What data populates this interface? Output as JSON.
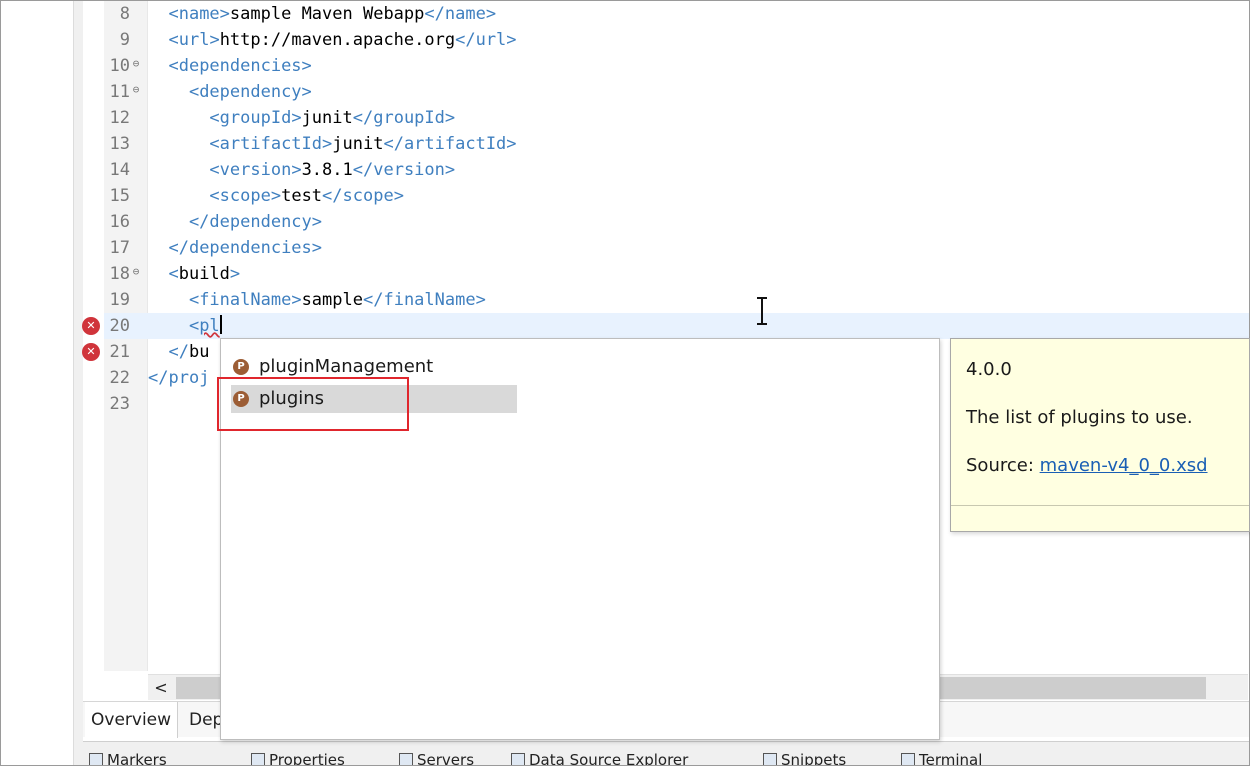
{
  "editor": {
    "lines": [
      {
        "num": "8",
        "fold": false,
        "error": false,
        "current": false,
        "parts": [
          [
            "tg",
            "  <"
          ],
          [
            "tg",
            "name"
          ],
          [
            "tg",
            ">"
          ],
          [
            "bk",
            "sample Maven Webapp"
          ],
          [
            "tg",
            "</"
          ],
          [
            "tg",
            "name"
          ],
          [
            "tg",
            ">"
          ]
        ]
      },
      {
        "num": "9",
        "fold": false,
        "error": false,
        "current": false,
        "parts": [
          [
            "tg",
            "  <"
          ],
          [
            "tg",
            "url"
          ],
          [
            "tg",
            ">"
          ],
          [
            "bk",
            "http://maven.apache.org"
          ],
          [
            "tg",
            "</"
          ],
          [
            "tg",
            "url"
          ],
          [
            "tg",
            ">"
          ]
        ]
      },
      {
        "num": "10",
        "fold": true,
        "error": false,
        "current": false,
        "parts": [
          [
            "tg",
            "  <"
          ],
          [
            "tg",
            "dependencies"
          ],
          [
            "tg",
            ">"
          ]
        ]
      },
      {
        "num": "11",
        "fold": true,
        "error": false,
        "current": false,
        "parts": [
          [
            "tg",
            "    <"
          ],
          [
            "tg",
            "dependency"
          ],
          [
            "tg",
            ">"
          ]
        ]
      },
      {
        "num": "12",
        "fold": false,
        "error": false,
        "current": false,
        "parts": [
          [
            "tg",
            "      <"
          ],
          [
            "tg",
            "groupId"
          ],
          [
            "tg",
            ">"
          ],
          [
            "bk",
            "junit"
          ],
          [
            "tg",
            "</"
          ],
          [
            "tg",
            "groupId"
          ],
          [
            "tg",
            ">"
          ]
        ]
      },
      {
        "num": "13",
        "fold": false,
        "error": false,
        "current": false,
        "parts": [
          [
            "tg",
            "      <"
          ],
          [
            "tg",
            "artifactId"
          ],
          [
            "tg",
            ">"
          ],
          [
            "bk",
            "junit"
          ],
          [
            "tg",
            "</"
          ],
          [
            "tg",
            "artifactId"
          ],
          [
            "tg",
            ">"
          ]
        ]
      },
      {
        "num": "14",
        "fold": false,
        "error": false,
        "current": false,
        "parts": [
          [
            "tg",
            "      <"
          ],
          [
            "tg",
            "version"
          ],
          [
            "tg",
            ">"
          ],
          [
            "bk",
            "3.8.1"
          ],
          [
            "tg",
            "</"
          ],
          [
            "tg",
            "version"
          ],
          [
            "tg",
            ">"
          ]
        ]
      },
      {
        "num": "15",
        "fold": false,
        "error": false,
        "current": false,
        "parts": [
          [
            "tg",
            "      <"
          ],
          [
            "tg",
            "scope"
          ],
          [
            "tg",
            ">"
          ],
          [
            "bk",
            "test"
          ],
          [
            "tg",
            "</"
          ],
          [
            "tg",
            "scope"
          ],
          [
            "tg",
            ">"
          ]
        ]
      },
      {
        "num": "16",
        "fold": false,
        "error": false,
        "current": false,
        "parts": [
          [
            "tg",
            "    </"
          ],
          [
            "tg",
            "dependency"
          ],
          [
            "tg",
            ">"
          ]
        ]
      },
      {
        "num": "17",
        "fold": false,
        "error": false,
        "current": false,
        "parts": [
          [
            "tg",
            "  </"
          ],
          [
            "tg",
            "dependencies"
          ],
          [
            "tg",
            ">"
          ]
        ]
      },
      {
        "num": "18",
        "fold": true,
        "error": false,
        "current": false,
        "parts": [
          [
            "tg",
            "  <"
          ],
          [
            "bk",
            "build"
          ],
          [
            "tg",
            ">"
          ]
        ]
      },
      {
        "num": "19",
        "fold": false,
        "error": false,
        "current": false,
        "parts": [
          [
            "tg",
            "    <"
          ],
          [
            "tg",
            "finalName"
          ],
          [
            "tg",
            ">"
          ],
          [
            "bk",
            "sample"
          ],
          [
            "tg",
            "</"
          ],
          [
            "tg",
            "finalName"
          ],
          [
            "tg",
            ">"
          ]
        ]
      },
      {
        "num": "20",
        "fold": false,
        "error": true,
        "current": true,
        "parts": [
          [
            "tg",
            "    <"
          ],
          [
            "squig",
            "pl"
          ]
        ]
      },
      {
        "num": "21",
        "fold": false,
        "error": true,
        "current": false,
        "parts": [
          [
            "tg",
            "  </"
          ],
          [
            "bk",
            "bu"
          ]
        ]
      },
      {
        "num": "22",
        "fold": false,
        "error": false,
        "current": false,
        "parts": [
          [
            "tg",
            "</"
          ],
          [
            "tg",
            "proj"
          ]
        ]
      },
      {
        "num": "23",
        "fold": false,
        "error": false,
        "current": false,
        "parts": []
      }
    ]
  },
  "content_assist": {
    "proposals": [
      {
        "label": "pluginManagement",
        "icon": "P",
        "selected": false
      },
      {
        "label": "plugins",
        "icon": "P",
        "selected": true
      }
    ]
  },
  "info_popup": {
    "version": "4.0.0",
    "description": "The list of plugins to use.",
    "source_label": "Source:",
    "source_link": "maven-v4_0_0.xsd"
  },
  "scrollbar": {
    "left_arrow": "<"
  },
  "editor_tabs": [
    {
      "label": "Overview",
      "active": true
    },
    {
      "label": "Dep",
      "active": false
    }
  ],
  "bottom_views": [
    {
      "label": "Markers",
      "icon": "markers-icon"
    },
    {
      "label": "Properties",
      "icon": "properties-icon"
    },
    {
      "label": "Servers",
      "icon": "servers-icon"
    },
    {
      "label": "Data Source Explorer",
      "icon": "data-source-explorer-icon"
    },
    {
      "label": "Snippets",
      "icon": "snippets-icon"
    },
    {
      "label": "Terminal",
      "icon": "terminal-icon"
    }
  ],
  "colors": {
    "tag": "#3f7fbf",
    "text": "#000000",
    "error": "#d0343b",
    "selection": "#d9d9d9",
    "highlight_box": "#e0262d"
  }
}
